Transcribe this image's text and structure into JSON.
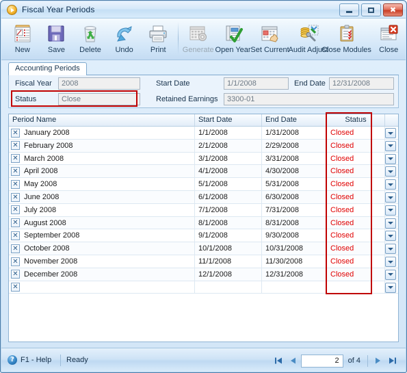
{
  "window": {
    "title": "Fiscal Year Periods",
    "title_icon": "play-circle-icon",
    "controls": [
      {
        "name": "minimize",
        "glyph": "minimize-icon"
      },
      {
        "name": "maximize",
        "glyph": "maximize-icon"
      },
      {
        "name": "close",
        "glyph": "close-icon",
        "label": "✖"
      }
    ]
  },
  "toolbar": {
    "buttons": [
      {
        "label": "New",
        "icon": "new-document-icon",
        "disabled": false
      },
      {
        "label": "Save",
        "icon": "floppy-disk-save-icon",
        "disabled": false
      },
      {
        "label": "Delete",
        "icon": "recycle-bin-delete-icon",
        "disabled": false
      },
      {
        "label": "Undo",
        "icon": "undo-arrow-icon",
        "disabled": false
      },
      {
        "label": "Print",
        "icon": "printer-icon",
        "disabled": false
      },
      {
        "label": "Generate",
        "icon": "calendar-gear-icon",
        "disabled": true
      },
      {
        "label": "Open Year",
        "icon": "open-year-checkmark-icon",
        "disabled": false
      },
      {
        "label": "Set Current",
        "icon": "calendar-hand-icon",
        "disabled": false
      },
      {
        "label": "Audit Adjust",
        "icon": "coins-wrench-icon",
        "disabled": false
      },
      {
        "label": "Close Modules",
        "icon": "clipboard-check-icon",
        "disabled": false
      },
      {
        "label": "Close",
        "icon": "window-close-red-icon",
        "disabled": false
      }
    ]
  },
  "tabs": [
    {
      "label": "Accounting Periods",
      "active": true
    }
  ],
  "form": {
    "fiscal_year": {
      "label": "Fiscal Year",
      "value": "2008"
    },
    "status": {
      "label": "Status",
      "value": "Close"
    },
    "start_date": {
      "label": "Start Date",
      "value": "1/1/2008"
    },
    "end_date": {
      "label": "End Date",
      "value": "12/31/2008"
    },
    "retained_earnings": {
      "label": "Retained Earnings",
      "value": "3300-01"
    }
  },
  "highlights": {
    "color": "#c00000",
    "regions": [
      "status-field",
      "status-column"
    ]
  },
  "grid": {
    "columns": [
      {
        "key": "period_name",
        "label": "Period Name",
        "align": "left"
      },
      {
        "key": "start_date",
        "label": "Start Date",
        "align": "left"
      },
      {
        "key": "end_date",
        "label": "End Date",
        "align": "left"
      },
      {
        "key": "status",
        "label": "Status",
        "align": "center"
      },
      {
        "key": "dropdown",
        "label": "",
        "align": "center"
      }
    ],
    "status_color": "#e00000",
    "row_selector_glyph": "✕",
    "rows": [
      {
        "period_name": "January 2008",
        "start_date": "1/1/2008",
        "end_date": "1/31/2008",
        "status": "Closed"
      },
      {
        "period_name": "February 2008",
        "start_date": "2/1/2008",
        "end_date": "2/29/2008",
        "status": "Closed"
      },
      {
        "period_name": "March 2008",
        "start_date": "3/1/2008",
        "end_date": "3/31/2008",
        "status": "Closed"
      },
      {
        "period_name": "April 2008",
        "start_date": "4/1/2008",
        "end_date": "4/30/2008",
        "status": "Closed"
      },
      {
        "period_name": "May 2008",
        "start_date": "5/1/2008",
        "end_date": "5/31/2008",
        "status": "Closed"
      },
      {
        "period_name": "June 2008",
        "start_date": "6/1/2008",
        "end_date": "6/30/2008",
        "status": "Closed"
      },
      {
        "period_name": "July 2008",
        "start_date": "7/1/2008",
        "end_date": "7/31/2008",
        "status": "Closed"
      },
      {
        "period_name": "August 2008",
        "start_date": "8/1/2008",
        "end_date": "8/31/2008",
        "status": "Closed"
      },
      {
        "period_name": "September 2008",
        "start_date": "9/1/2008",
        "end_date": "9/30/2008",
        "status": "Closed"
      },
      {
        "period_name": "October 2008",
        "start_date": "10/1/2008",
        "end_date": "10/31/2008",
        "status": "Closed"
      },
      {
        "period_name": "November 2008",
        "start_date": "11/1/2008",
        "end_date": "11/30/2008",
        "status": "Closed"
      },
      {
        "period_name": "December 2008",
        "start_date": "12/1/2008",
        "end_date": "12/31/2008",
        "status": "Closed"
      },
      {
        "period_name": "",
        "start_date": "",
        "end_date": "",
        "status": ""
      }
    ]
  },
  "statusbar": {
    "help_label": "F1 - Help",
    "help_icon": "question-mark-icon",
    "state": "Ready",
    "nav": {
      "first": "first-record-icon",
      "prev": "previous-record-icon",
      "current": "2",
      "of_label": "of",
      "total": "4",
      "next": "next-record-icon",
      "last": "last-record-icon"
    }
  }
}
